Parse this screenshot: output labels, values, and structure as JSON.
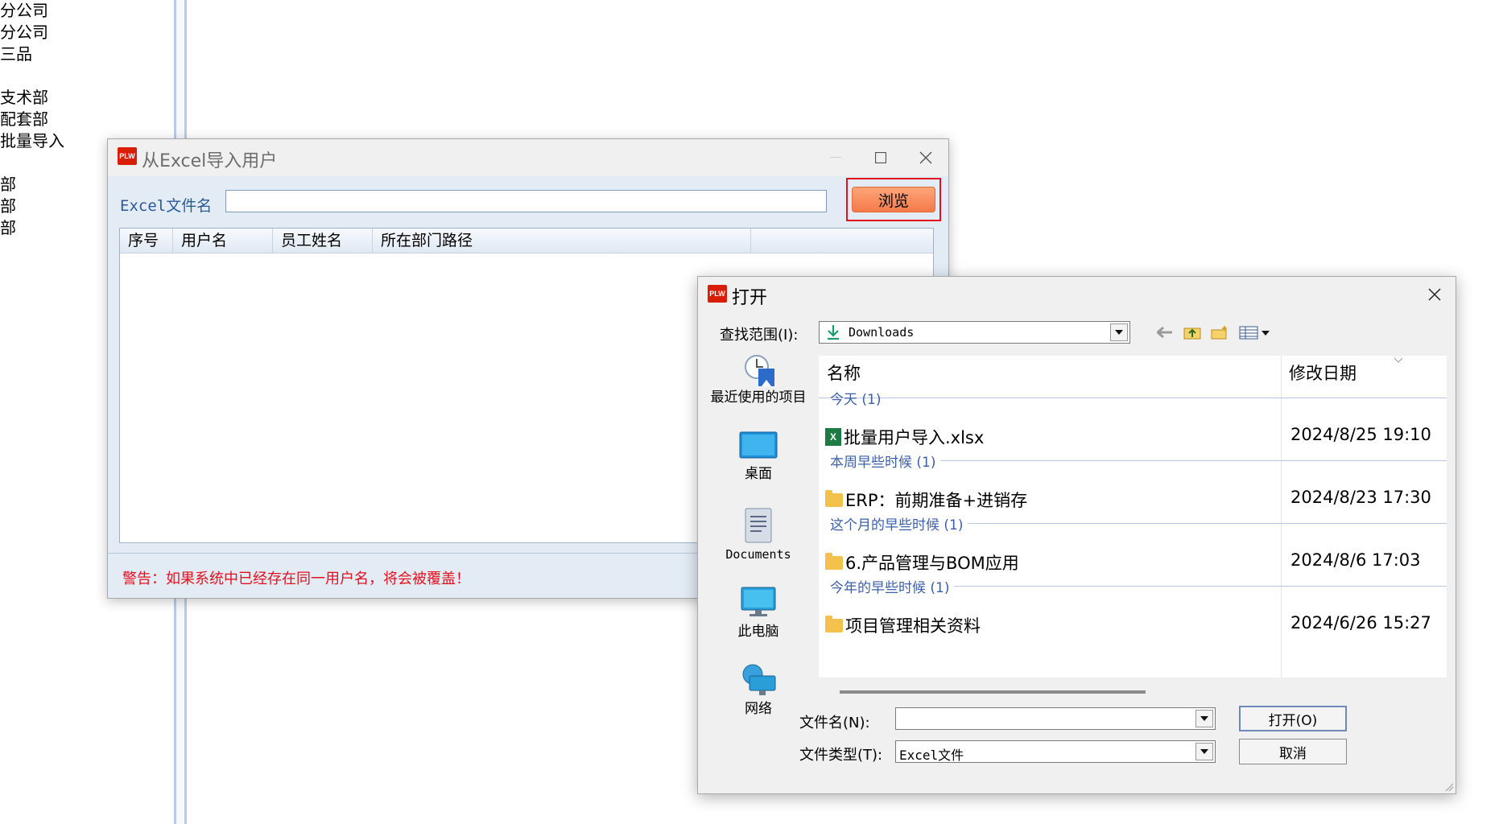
{
  "background": {
    "tree_items": [
      "分公司",
      "分公司",
      "三品",
      "",
      "支术部",
      "配套部",
      "批量导入",
      "",
      "部",
      "部",
      "部"
    ]
  },
  "import_dialog": {
    "title": "从Excel导入用户",
    "file_label": "Excel文件名",
    "file_value": "",
    "browse_label": "浏览",
    "columns": [
      "序号",
      "用户名",
      "员工姓名",
      "所在部门路径"
    ],
    "warning": "警告：如果系统中已经存在同一用户名，将会被覆盖！"
  },
  "open_dialog": {
    "title": "打开",
    "lookin_label": "查找范围(I):",
    "lookin_value": "Downloads",
    "places": [
      {
        "label": "最近使用的项目",
        "icon": "recent-items-icon"
      },
      {
        "label": "桌面",
        "icon": "desktop-icon"
      },
      {
        "label": "Documents",
        "icon": "documents-icon"
      },
      {
        "label": "此电脑",
        "icon": "this-pc-icon"
      },
      {
        "label": "网络",
        "icon": "network-icon"
      }
    ],
    "columns": {
      "name": "名称",
      "modified": "修改日期"
    },
    "groups": [
      {
        "label": "今天 (1)",
        "file": {
          "name": "批量用户导入.xlsx",
          "date": "2024/8/25 19:10",
          "type": "xlsx"
        }
      },
      {
        "label": "本周早些时候 (1)",
        "file": {
          "name": "ERP：前期准备+进销存",
          "date": "2024/8/23 17:30",
          "type": "folder"
        }
      },
      {
        "label": "这个月的早些时候 (1)",
        "file": {
          "name": "6.产品管理与BOM应用",
          "date": "2024/8/6 17:03",
          "type": "folder"
        }
      },
      {
        "label": "今年的早些时候 (1)",
        "file": {
          "name": "项目管理相关资料",
          "date": "2024/6/26 15:27",
          "type": "folder"
        }
      }
    ],
    "filename_label": "文件名(N):",
    "filename_value": "",
    "filetype_label": "文件类型(T):",
    "filetype_value": "Excel文件",
    "open_button": "打开(O)",
    "cancel_button": "取消"
  },
  "colors": {
    "browse_button": "#f47a48",
    "highlight_frame": "#e3111d",
    "warning": "#e3111d",
    "group_header": "#3b5fa9"
  }
}
